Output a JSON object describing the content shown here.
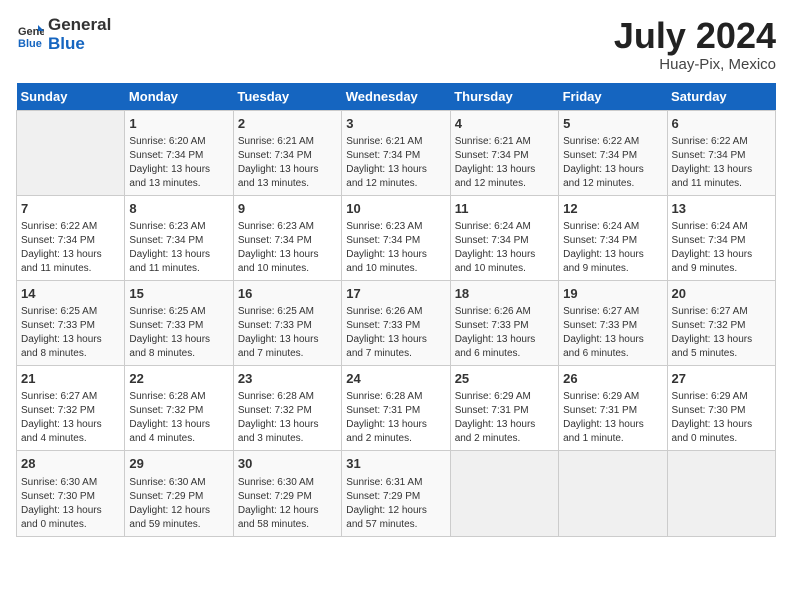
{
  "logo": {
    "text_general": "General",
    "text_blue": "Blue"
  },
  "title": {
    "month_year": "July 2024",
    "location": "Huay-Pix, Mexico"
  },
  "weekdays": [
    "Sunday",
    "Monday",
    "Tuesday",
    "Wednesday",
    "Thursday",
    "Friday",
    "Saturday"
  ],
  "weeks": [
    [
      {
        "day": "",
        "info": ""
      },
      {
        "day": "1",
        "info": "Sunrise: 6:20 AM\nSunset: 7:34 PM\nDaylight: 13 hours\nand 13 minutes."
      },
      {
        "day": "2",
        "info": "Sunrise: 6:21 AM\nSunset: 7:34 PM\nDaylight: 13 hours\nand 13 minutes."
      },
      {
        "day": "3",
        "info": "Sunrise: 6:21 AM\nSunset: 7:34 PM\nDaylight: 13 hours\nand 12 minutes."
      },
      {
        "day": "4",
        "info": "Sunrise: 6:21 AM\nSunset: 7:34 PM\nDaylight: 13 hours\nand 12 minutes."
      },
      {
        "day": "5",
        "info": "Sunrise: 6:22 AM\nSunset: 7:34 PM\nDaylight: 13 hours\nand 12 minutes."
      },
      {
        "day": "6",
        "info": "Sunrise: 6:22 AM\nSunset: 7:34 PM\nDaylight: 13 hours\nand 11 minutes."
      }
    ],
    [
      {
        "day": "7",
        "info": "Sunrise: 6:22 AM\nSunset: 7:34 PM\nDaylight: 13 hours\nand 11 minutes."
      },
      {
        "day": "8",
        "info": "Sunrise: 6:23 AM\nSunset: 7:34 PM\nDaylight: 13 hours\nand 11 minutes."
      },
      {
        "day": "9",
        "info": "Sunrise: 6:23 AM\nSunset: 7:34 PM\nDaylight: 13 hours\nand 10 minutes."
      },
      {
        "day": "10",
        "info": "Sunrise: 6:23 AM\nSunset: 7:34 PM\nDaylight: 13 hours\nand 10 minutes."
      },
      {
        "day": "11",
        "info": "Sunrise: 6:24 AM\nSunset: 7:34 PM\nDaylight: 13 hours\nand 10 minutes."
      },
      {
        "day": "12",
        "info": "Sunrise: 6:24 AM\nSunset: 7:34 PM\nDaylight: 13 hours\nand 9 minutes."
      },
      {
        "day": "13",
        "info": "Sunrise: 6:24 AM\nSunset: 7:34 PM\nDaylight: 13 hours\nand 9 minutes."
      }
    ],
    [
      {
        "day": "14",
        "info": "Sunrise: 6:25 AM\nSunset: 7:33 PM\nDaylight: 13 hours\nand 8 minutes."
      },
      {
        "day": "15",
        "info": "Sunrise: 6:25 AM\nSunset: 7:33 PM\nDaylight: 13 hours\nand 8 minutes."
      },
      {
        "day": "16",
        "info": "Sunrise: 6:25 AM\nSunset: 7:33 PM\nDaylight: 13 hours\nand 7 minutes."
      },
      {
        "day": "17",
        "info": "Sunrise: 6:26 AM\nSunset: 7:33 PM\nDaylight: 13 hours\nand 7 minutes."
      },
      {
        "day": "18",
        "info": "Sunrise: 6:26 AM\nSunset: 7:33 PM\nDaylight: 13 hours\nand 6 minutes."
      },
      {
        "day": "19",
        "info": "Sunrise: 6:27 AM\nSunset: 7:33 PM\nDaylight: 13 hours\nand 6 minutes."
      },
      {
        "day": "20",
        "info": "Sunrise: 6:27 AM\nSunset: 7:32 PM\nDaylight: 13 hours\nand 5 minutes."
      }
    ],
    [
      {
        "day": "21",
        "info": "Sunrise: 6:27 AM\nSunset: 7:32 PM\nDaylight: 13 hours\nand 4 minutes."
      },
      {
        "day": "22",
        "info": "Sunrise: 6:28 AM\nSunset: 7:32 PM\nDaylight: 13 hours\nand 4 minutes."
      },
      {
        "day": "23",
        "info": "Sunrise: 6:28 AM\nSunset: 7:32 PM\nDaylight: 13 hours\nand 3 minutes."
      },
      {
        "day": "24",
        "info": "Sunrise: 6:28 AM\nSunset: 7:31 PM\nDaylight: 13 hours\nand 2 minutes."
      },
      {
        "day": "25",
        "info": "Sunrise: 6:29 AM\nSunset: 7:31 PM\nDaylight: 13 hours\nand 2 minutes."
      },
      {
        "day": "26",
        "info": "Sunrise: 6:29 AM\nSunset: 7:31 PM\nDaylight: 13 hours\nand 1 minute."
      },
      {
        "day": "27",
        "info": "Sunrise: 6:29 AM\nSunset: 7:30 PM\nDaylight: 13 hours\nand 0 minutes."
      }
    ],
    [
      {
        "day": "28",
        "info": "Sunrise: 6:30 AM\nSunset: 7:30 PM\nDaylight: 13 hours\nand 0 minutes."
      },
      {
        "day": "29",
        "info": "Sunrise: 6:30 AM\nSunset: 7:29 PM\nDaylight: 12 hours\nand 59 minutes."
      },
      {
        "day": "30",
        "info": "Sunrise: 6:30 AM\nSunset: 7:29 PM\nDaylight: 12 hours\nand 58 minutes."
      },
      {
        "day": "31",
        "info": "Sunrise: 6:31 AM\nSunset: 7:29 PM\nDaylight: 12 hours\nand 57 minutes."
      },
      {
        "day": "",
        "info": ""
      },
      {
        "day": "",
        "info": ""
      },
      {
        "day": "",
        "info": ""
      }
    ]
  ]
}
